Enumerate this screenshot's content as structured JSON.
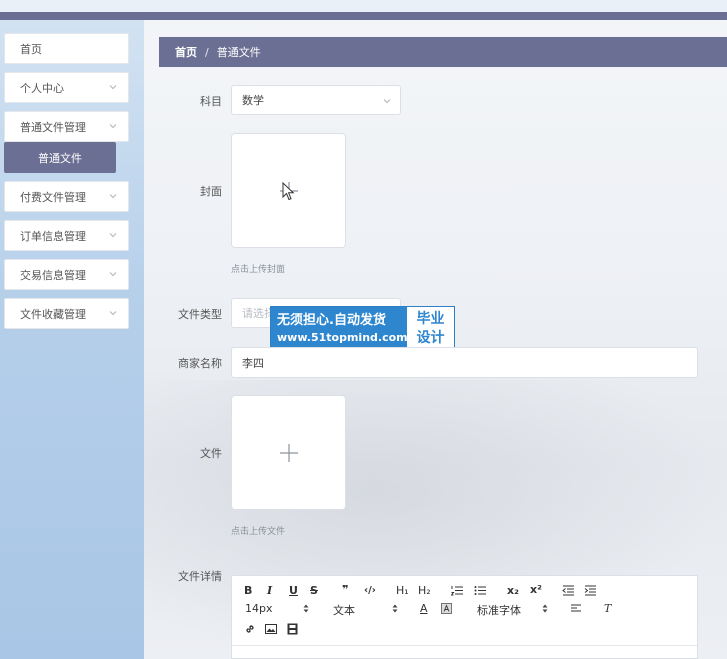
{
  "sidebar": {
    "items": [
      {
        "label": "首页",
        "has_children": false
      },
      {
        "label": "个人中心",
        "has_children": true
      },
      {
        "label": "普通文件管理",
        "has_children": true
      },
      {
        "label": "付费文件管理",
        "has_children": true
      },
      {
        "label": "订单信息管理",
        "has_children": true
      },
      {
        "label": "交易信息管理",
        "has_children": true
      },
      {
        "label": "文件收藏管理",
        "has_children": true
      }
    ],
    "active_submenu": "普通文件"
  },
  "breadcrumb": {
    "home": "首页",
    "separator": "/",
    "current": "普通文件"
  },
  "form": {
    "subject": {
      "label": "科目",
      "value": "数学"
    },
    "cover": {
      "label": "封面",
      "hint": "点击上传封面"
    },
    "file_type": {
      "label": "文件类型",
      "placeholder": "请选择"
    },
    "merchant_name": {
      "label": "商家名称",
      "value": "李四"
    },
    "file": {
      "label": "文件",
      "hint": "点击上传文件"
    },
    "file_detail": {
      "label": "文件详情"
    }
  },
  "editor_toolbar": {
    "row1": {
      "bold": "B",
      "italic": "I",
      "underline": "U",
      "strike": "S",
      "quote": "❞",
      "code": "‹/›",
      "h1": "H₁",
      "h2": "H₂",
      "subscript": "x₂",
      "superscript": "x²"
    },
    "row2": {
      "size": "14px",
      "format": "文本",
      "text_color": "A",
      "font": "标准字体",
      "clear": "T"
    }
  },
  "watermark": {
    "line1": "无须担心.自动发货",
    "line2": "www.51topmind.com",
    "badge_line1": "毕业",
    "badge_line2": "设计"
  },
  "colors": {
    "primary": "#6b6f93",
    "sidebar_bg": "#b5cfea",
    "watermark_blue": "#2e86cf"
  }
}
